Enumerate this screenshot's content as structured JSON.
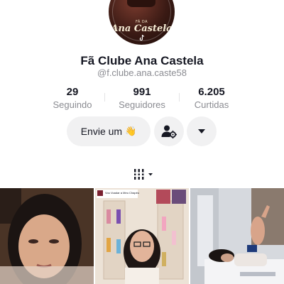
{
  "profile": {
    "avatar_small_text": "FÃ DA",
    "avatar_script_text": "Ana Castela",
    "avatar_badge_icon": "tiktok-icon",
    "name": "Fã Clube Ana Castela",
    "handle": "@f.clube.ana.caste58"
  },
  "stats": [
    {
      "value": "29",
      "label": "Seguindo"
    },
    {
      "value": "991",
      "label": "Seguidores"
    },
    {
      "value": "6.205",
      "label": "Curtidas"
    }
  ],
  "actions": {
    "message_label": "Envie um",
    "message_emoji": "👋",
    "user_settings_icon": "user-gear-icon",
    "more_icon": "caret-down-icon"
  },
  "tabs": {
    "grid_icon": "videos-grid-icon"
  },
  "videos": [
    {
      "kind": "selfie-video",
      "overlay_text": ""
    },
    {
      "kind": "room-video",
      "overlay_text": "Vou Voadar a Meu Chapéu"
    },
    {
      "kind": "hospital-video",
      "overlay_text": ""
    }
  ],
  "colors": {
    "text_primary": "#161823",
    "text_secondary": "#8a8b91",
    "button_bg": "#f1f1f2"
  }
}
